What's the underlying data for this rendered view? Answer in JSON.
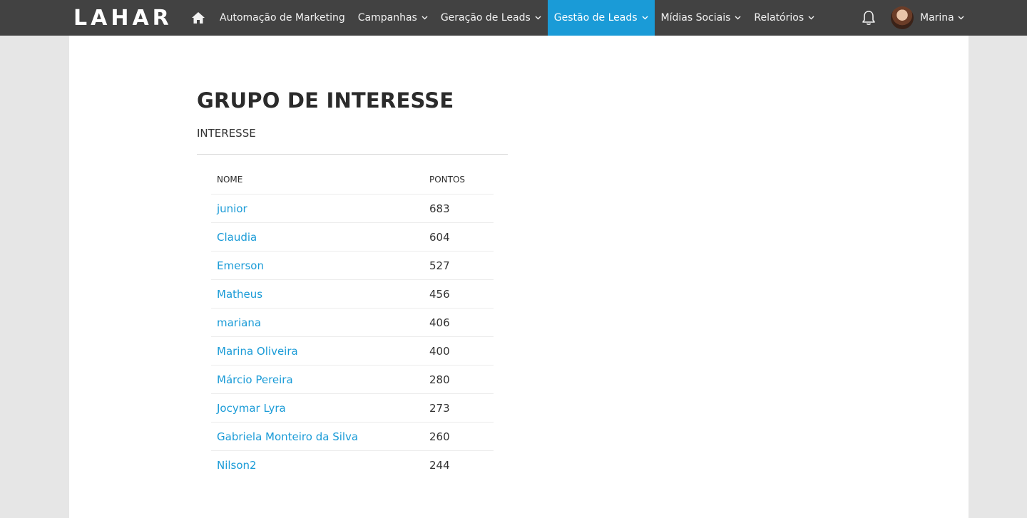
{
  "app": {
    "logo_text": "LAHAR",
    "brand_color": "#1a9bd7",
    "topbar_color": "#424242"
  },
  "nav": {
    "home_icon": "home-icon",
    "items": [
      {
        "label": "Automação de Marketing",
        "dropdown": false,
        "active": false
      },
      {
        "label": "Campanhas",
        "dropdown": true,
        "active": false
      },
      {
        "label": "Geração de Leads",
        "dropdown": true,
        "active": false
      },
      {
        "label": "Gestão de Leads",
        "dropdown": true,
        "active": true
      },
      {
        "label": "Mídias Sociais",
        "dropdown": true,
        "active": false
      },
      {
        "label": "Relatórios",
        "dropdown": true,
        "active": false
      }
    ]
  },
  "user": {
    "name": "Marina",
    "notifications_icon": "bell-icon"
  },
  "page": {
    "title": "GRUPO DE INTERESSE",
    "subtitle": "INTERESSE"
  },
  "table": {
    "columns": [
      "NOME",
      "PONTOS"
    ],
    "rows": [
      {
        "name": "junior",
        "points": "683"
      },
      {
        "name": "Claudia",
        "points": "604"
      },
      {
        "name": "Emerson",
        "points": "527"
      },
      {
        "name": "Matheus",
        "points": "456"
      },
      {
        "name": "mariana",
        "points": "406"
      },
      {
        "name": "Marina Oliveira",
        "points": "400"
      },
      {
        "name": "Márcio Pereira",
        "points": "280"
      },
      {
        "name": "Jocymar Lyra",
        "points": "273"
      },
      {
        "name": "Gabriela Monteiro da Silva",
        "points": "260"
      },
      {
        "name": "Nilson2",
        "points": "244"
      }
    ]
  }
}
